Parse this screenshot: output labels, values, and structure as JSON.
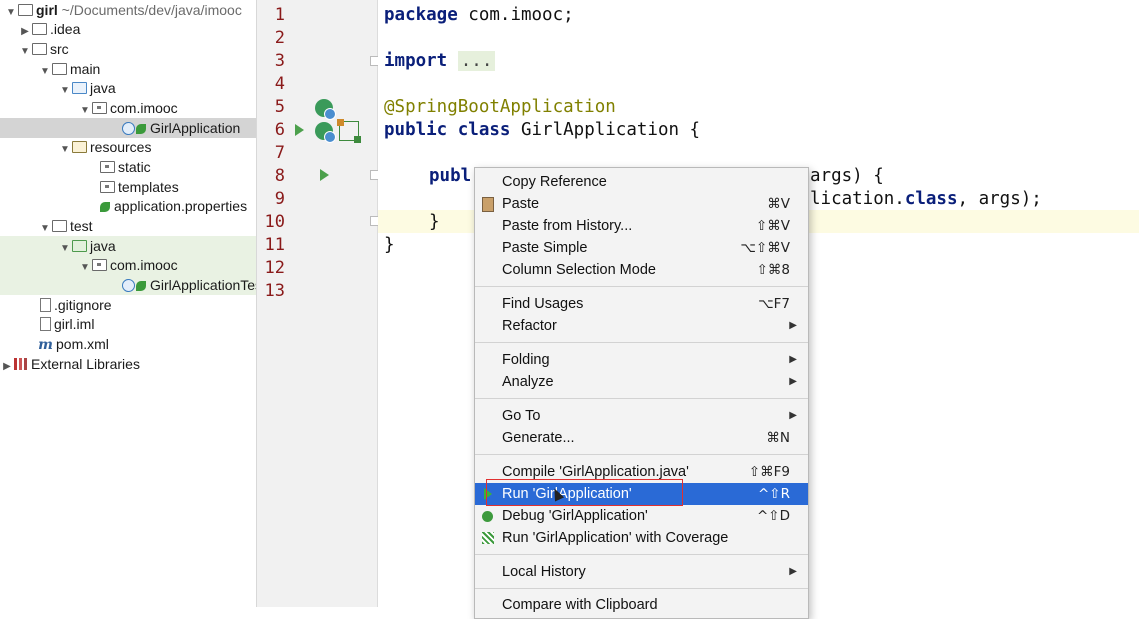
{
  "project_tree": {
    "root": {
      "name": "girl",
      "path": "~/Documents/dev/java/imooc"
    },
    "items": [
      {
        "label": "girl",
        "extra": "~/Documents/dev/java/imooc"
      },
      {
        "label": ".idea"
      },
      {
        "label": "src"
      },
      {
        "label": "main"
      },
      {
        "label": "java"
      },
      {
        "label": "com.imooc"
      },
      {
        "label": "GirlApplication"
      },
      {
        "label": "resources"
      },
      {
        "label": "static"
      },
      {
        "label": "templates"
      },
      {
        "label": "application.properties"
      },
      {
        "label": "test"
      },
      {
        "label": "java"
      },
      {
        "label": "com.imooc"
      },
      {
        "label": "GirlApplicationTests"
      },
      {
        "label": ".gitignore"
      },
      {
        "label": "girl.iml"
      },
      {
        "label": "m",
        "text": "pom.xml"
      },
      {
        "label": "External Libraries"
      }
    ]
  },
  "gutter": {
    "line_numbers": [
      "1",
      "2",
      "3",
      "4",
      "5",
      "6",
      "7",
      "8",
      "9",
      "10",
      "11",
      "12",
      "13"
    ]
  },
  "editor": {
    "line1_kw": "package",
    "line1_rest": " com.imooc;",
    "line3_kw": "import",
    "line3_fold": "...",
    "line6_ann": "@SpringBootApplication",
    "line7_kw": "public class",
    "line7_rest": " GirlApplication {",
    "line9_kw": "publ",
    "line9_rest": "args) {",
    "line10_a": "lication.",
    "line10_kw": "class",
    "line10_b": ", args);",
    "line11": "}",
    "line12": "}"
  },
  "context_menu": {
    "items": [
      {
        "label": "Copy Reference",
        "shortcut": ""
      },
      {
        "label": "Paste",
        "shortcut": "⌘V"
      },
      {
        "label": "Paste from History...",
        "shortcut": "⇧⌘V"
      },
      {
        "label": "Paste Simple",
        "shortcut": "⌥⇧⌘V"
      },
      {
        "label": "Column Selection Mode",
        "shortcut": "⇧⌘8"
      },
      {
        "label": "Find Usages",
        "shortcut": "⌥F7"
      },
      {
        "label": "Refactor",
        "shortcut": ""
      },
      {
        "label": "Folding",
        "shortcut": ""
      },
      {
        "label": "Analyze",
        "shortcut": ""
      },
      {
        "label": "Go To",
        "shortcut": ""
      },
      {
        "label": "Generate...",
        "shortcut": "⌘N"
      },
      {
        "label": "Compile 'GirlApplication.java'",
        "shortcut": "⇧⌘F9"
      },
      {
        "label": "Run 'GirlApplication'",
        "shortcut": "^⇧R"
      },
      {
        "label": "Debug 'GirlApplication'",
        "shortcut": "^⇧D"
      },
      {
        "label": "Run 'GirlApplication' with Coverage",
        "shortcut": ""
      },
      {
        "label": "Local History",
        "shortcut": ""
      },
      {
        "label": "Compare with Clipboard",
        "shortcut": ""
      }
    ],
    "submenu_arrow": "▶",
    "highlighted": "Run 'GirlApplication'"
  },
  "colors": {
    "selection": "#2a6ad6",
    "annotation_box": "#e03030",
    "line_numbers": "#8a1a1a",
    "keyword": "#0a1f7a",
    "annotation": "#808000"
  },
  "icons": [
    "folder-icon",
    "package-icon",
    "spring-class-icon",
    "run-gutter-icon",
    "bean-icon",
    "fold-icon",
    "paste-icon",
    "run-icon",
    "debug-icon",
    "coverage-icon",
    "library-icon",
    "file-icon"
  ]
}
